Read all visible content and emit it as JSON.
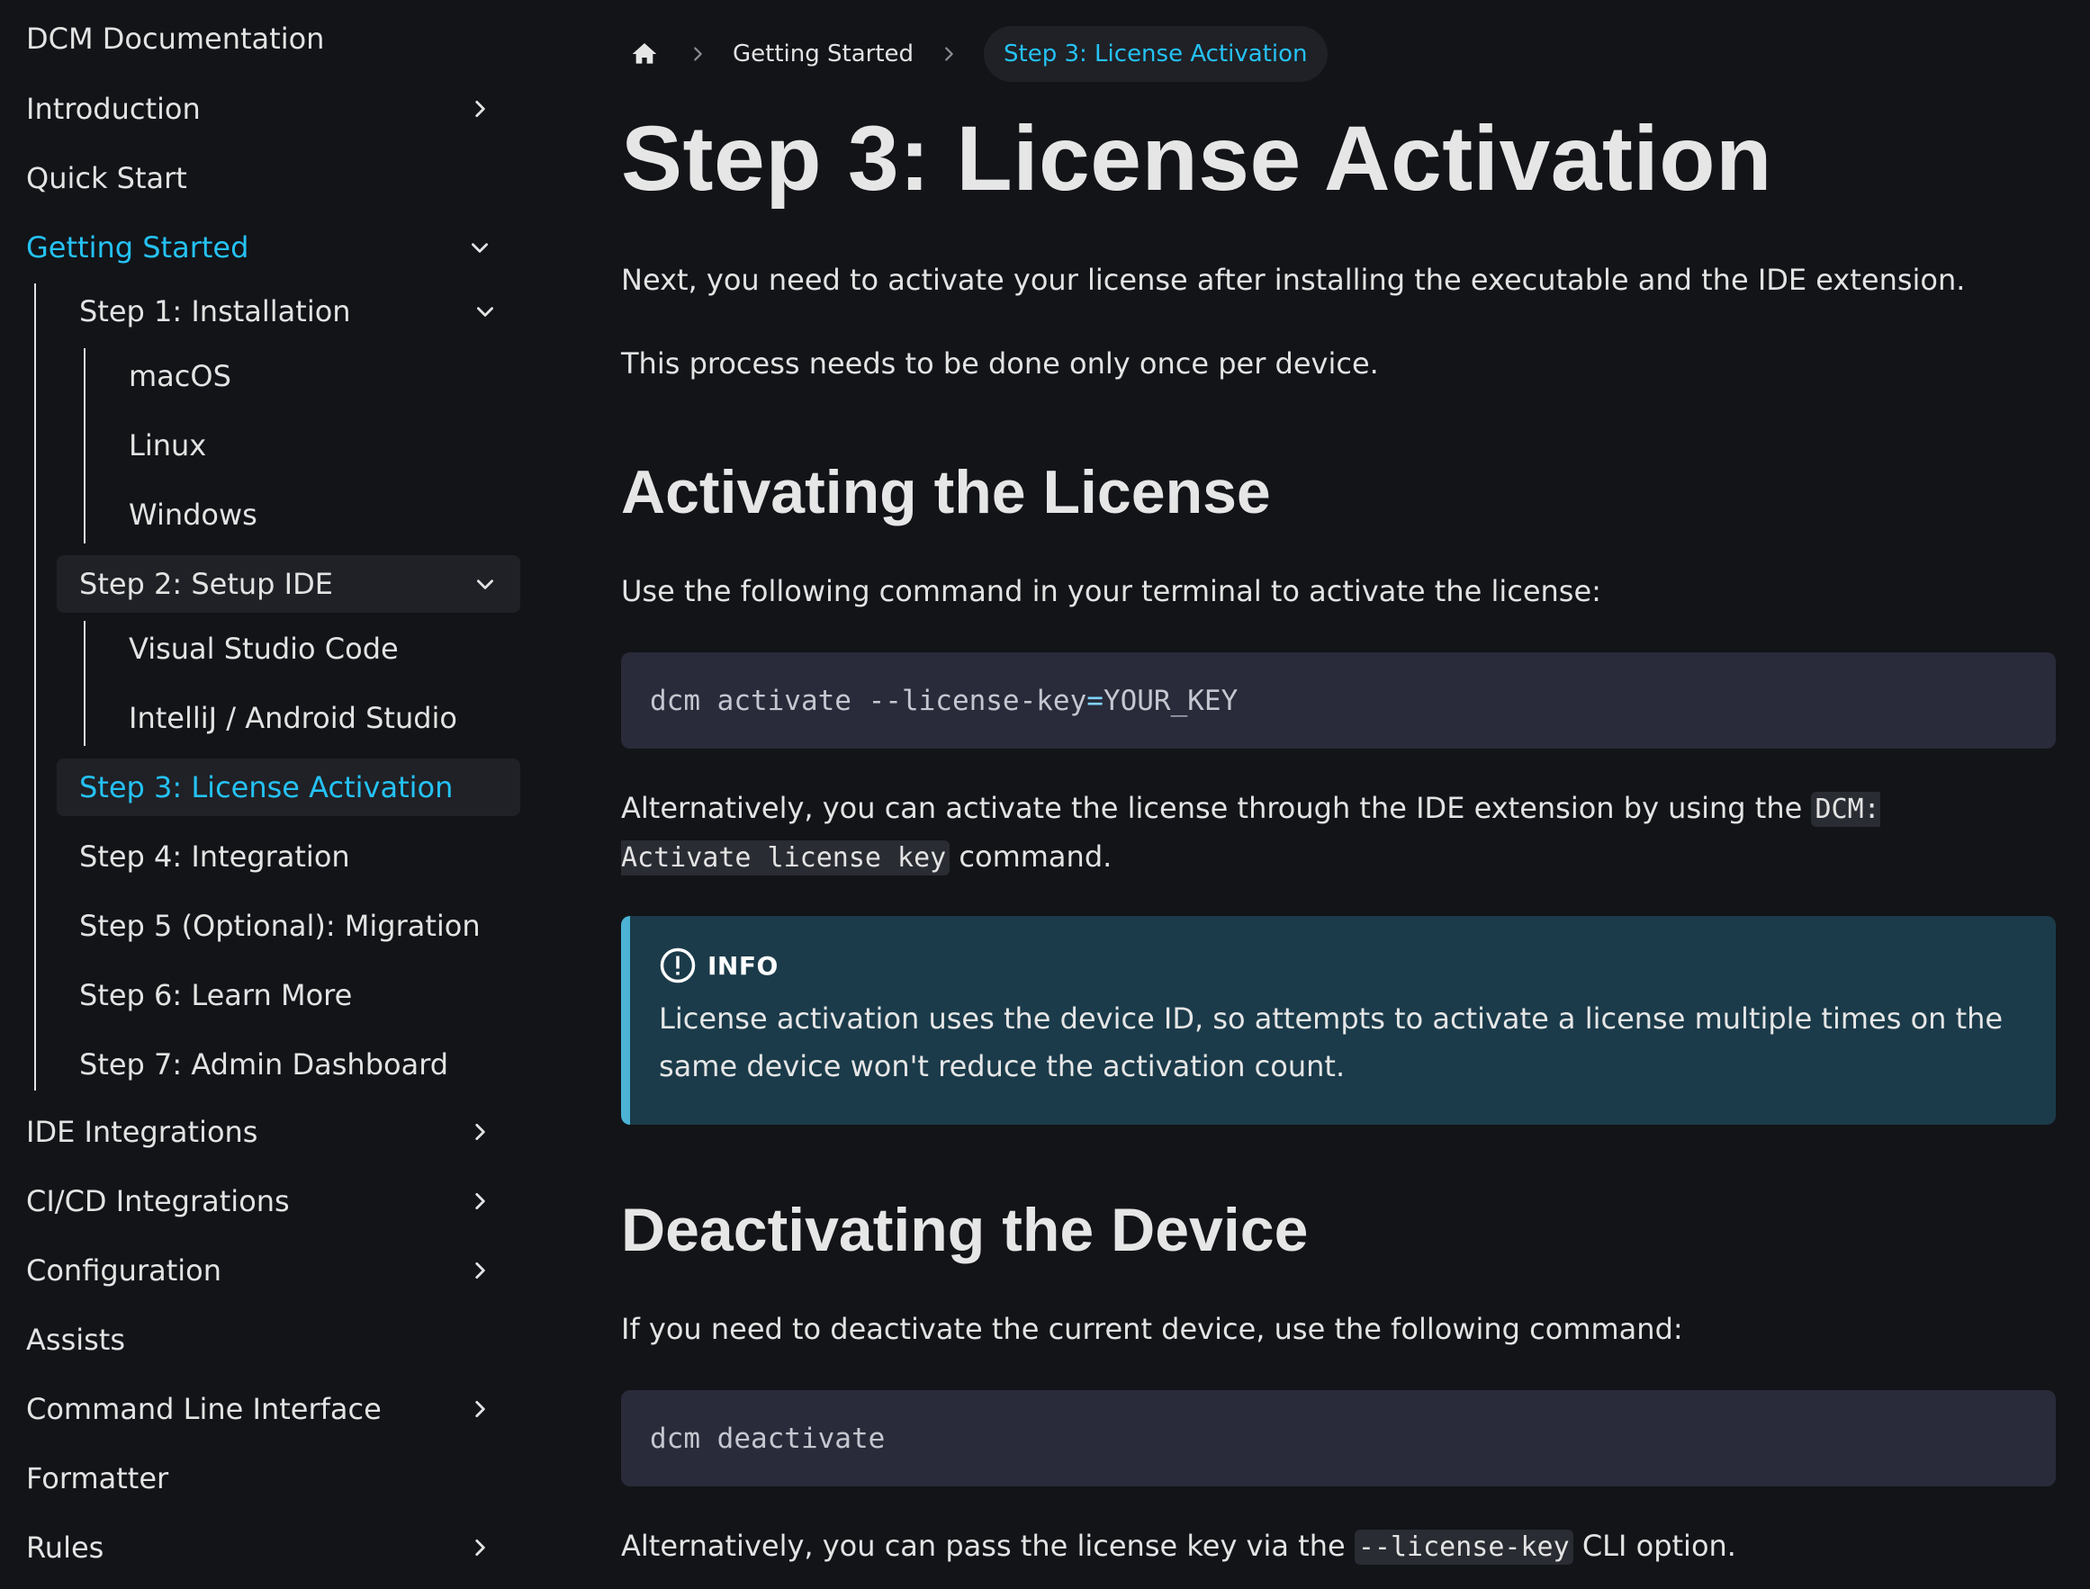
{
  "sidebar": {
    "title": "DCM Documentation",
    "items": [
      {
        "label": "Introduction"
      },
      {
        "label": "Quick Start"
      },
      {
        "label": "Getting Started"
      },
      {
        "label": "Step 1: Installation"
      },
      {
        "label": "macOS"
      },
      {
        "label": "Linux"
      },
      {
        "label": "Windows"
      },
      {
        "label": "Step 2: Setup IDE"
      },
      {
        "label": "Visual Studio Code"
      },
      {
        "label": "IntelliJ / Android Studio"
      },
      {
        "label": "Step 3: License Activation"
      },
      {
        "label": "Step 4: Integration"
      },
      {
        "label": "Step 5 (Optional): Migration"
      },
      {
        "label": "Step 6: Learn More"
      },
      {
        "label": "Step 7: Admin Dashboard"
      },
      {
        "label": "IDE Integrations"
      },
      {
        "label": "CI/CD Integrations"
      },
      {
        "label": "Configuration"
      },
      {
        "label": "Assists"
      },
      {
        "label": "Command Line Interface"
      },
      {
        "label": "Formatter"
      },
      {
        "label": "Rules"
      }
    ]
  },
  "breadcrumb": {
    "home_icon": "home-icon",
    "items": [
      "Getting Started",
      "Step 3: License Activation"
    ]
  },
  "main": {
    "title": "Step 3: License Activation",
    "intro_1": "Next, you need to activate your license after installing the executable and the IDE extension.",
    "intro_2": "This process needs to be done only once per device.",
    "section_1": {
      "heading": "Activating the License",
      "text": "Use the following command in your terminal to activate the license:",
      "code_before": "dcm activate --license-key",
      "code_eq": "=",
      "code_after": "YOUR_KEY",
      "alt_before": "Alternatively, you can activate the license through the IDE extension by using the ",
      "alt_code": "DCM: Activate license key",
      "alt_after": " command."
    },
    "info": {
      "label": "INFO",
      "text": "License activation uses the device ID, so attempts to activate a license multiple times on the same device won't reduce the activation count."
    },
    "section_2": {
      "heading": "Deactivating the Device",
      "text": "If you need to deactivate the current device, use the following command:",
      "code": "dcm deactivate",
      "alt_before": "Alternatively, you can pass the license key via the ",
      "alt_code": "--license-key",
      "alt_after": " CLI option."
    }
  },
  "colors": {
    "background": "#121418",
    "accent": "#25c2f5",
    "code_bg": "#292b3a",
    "info_bg": "#1b3b4a",
    "info_border": "#4cb3d4"
  }
}
